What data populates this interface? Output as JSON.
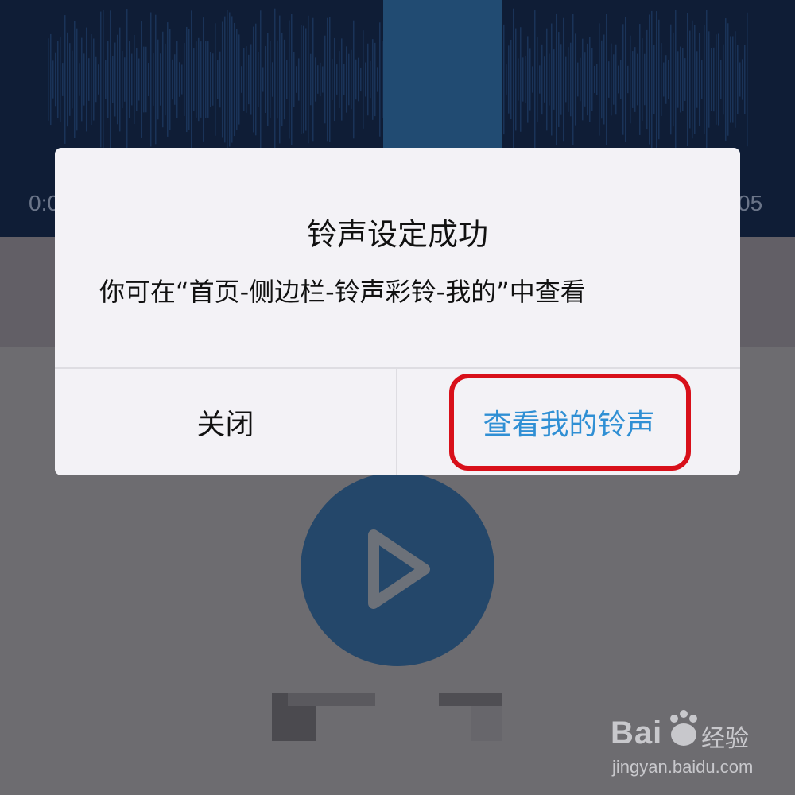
{
  "player": {
    "time_start": "0:0",
    "time_end": "05",
    "play_icon": "play-icon"
  },
  "dialog": {
    "title": "铃声设定成功",
    "message": "你可在“首页-侧边栏-铃声彩铃-我的”中查看",
    "close_label": "关闭",
    "view_label": "查看我的铃声"
  },
  "watermark": {
    "brand": "Bai",
    "brand_cn": "经验",
    "url": "jingyan.baidu.com"
  },
  "colors": {
    "accent": "#2f8fd4",
    "highlight": "#d8101a",
    "play_button": "#24476a",
    "waveform_bg": "#0f1d36"
  }
}
